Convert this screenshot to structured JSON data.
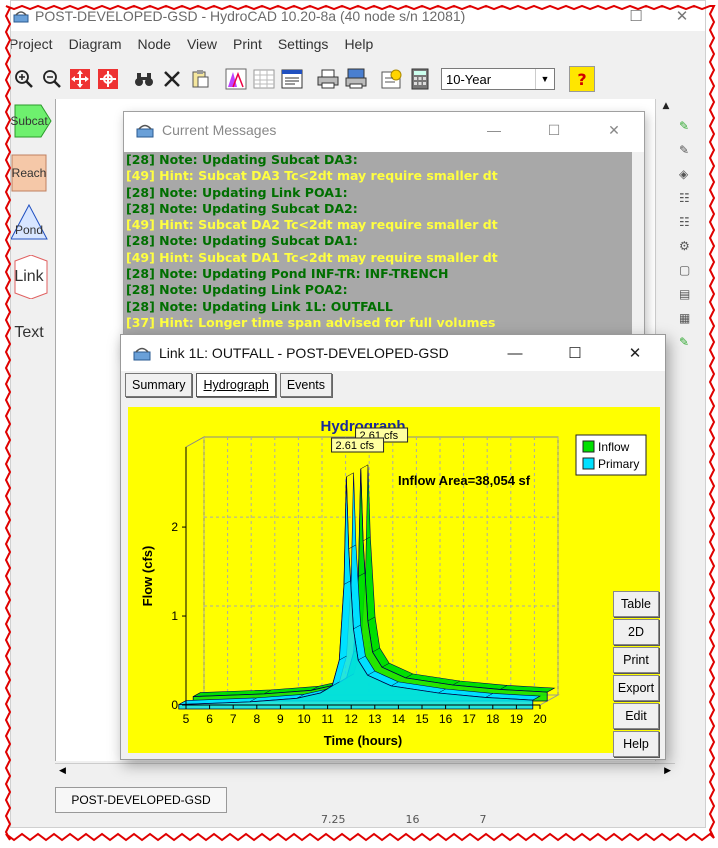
{
  "app": {
    "title": "POST-DEVELOPED-GSD - HydroCAD 10.20-8a  (40 node s/n 12081)"
  },
  "menu": [
    "Project",
    "Diagram",
    "Node",
    "View",
    "Print",
    "Settings",
    "Help"
  ],
  "toolbar": {
    "storm_select": "10-Year"
  },
  "palette": [
    "Subcat",
    "Reach",
    "Pond",
    "Link",
    "Text"
  ],
  "messages_window": {
    "title": "Current Messages",
    "lines": [
      {
        "kind": "note",
        "text": "[28] Note: Updating Subcat DA3:"
      },
      {
        "kind": "hint",
        "text": "[49] Hint: Subcat DA3 Tc<2dt may require smaller dt"
      },
      {
        "kind": "note",
        "text": "[28] Note: Updating Link POA1:"
      },
      {
        "kind": "note",
        "text": "[28] Note: Updating Subcat DA2:"
      },
      {
        "kind": "hint",
        "text": "[49] Hint: Subcat DA2 Tc<2dt may require smaller dt"
      },
      {
        "kind": "note",
        "text": "[28] Note: Updating Subcat DA1:"
      },
      {
        "kind": "hint",
        "text": "[49] Hint: Subcat DA1 Tc<2dt may require smaller dt"
      },
      {
        "kind": "note",
        "text": "[28] Note: Updating Pond INF-TR: INF-TRENCH"
      },
      {
        "kind": "note",
        "text": "[28] Note: Updating Link POA2:"
      },
      {
        "kind": "note",
        "text": "[28] Note: Updating Link 1L: OUTFALL"
      },
      {
        "kind": "hint",
        "text": "[37] Hint: Longer time span advised for full volumes"
      }
    ],
    "colors": {
      "note": "#006f00",
      "hint": "#ffff40",
      "background": "#a8a8a8"
    }
  },
  "link_window": {
    "title": "Link 1L: OUTFALL - POST-DEVELOPED-GSD",
    "tabs": [
      "Summary",
      "Hydrograph",
      "Events"
    ],
    "active_tab": "Hydrograph",
    "side_buttons": [
      "Table",
      "2D",
      "Print",
      "Export",
      "Edit",
      "Help"
    ]
  },
  "chart_data": {
    "type": "area",
    "title": "Hydrograph",
    "xlabel": "Time  (hours)",
    "ylabel": "Flow  (cfs)",
    "x_ticks": [
      5,
      6,
      7,
      8,
      9,
      10,
      11,
      12,
      13,
      14,
      15,
      16,
      17,
      18,
      19,
      20
    ],
    "y_ticks": [
      0,
      1,
      2
    ],
    "xlim": [
      5,
      20
    ],
    "ylim": [
      0,
      2.9
    ],
    "annotation": "Inflow Area=38,054 sf",
    "peak_labels": [
      "2.61 cfs",
      "2.61 cfs"
    ],
    "legend": {
      "placement": "top-right"
    },
    "series": [
      {
        "name": "Inflow",
        "color": "#00e000",
        "x": [
          5,
          8,
          10,
          11,
          11.5,
          11.8,
          12.0,
          12.1,
          12.2,
          12.4,
          12.6,
          13,
          14,
          16,
          18,
          20
        ],
        "y": [
          0.05,
          0.08,
          0.12,
          0.18,
          0.26,
          0.55,
          1.4,
          2.61,
          1.8,
          0.9,
          0.55,
          0.38,
          0.26,
          0.18,
          0.13,
          0.1
        ]
      },
      {
        "name": "Primary",
        "color": "#00e0ff",
        "x": [
          5,
          8,
          10,
          11,
          11.5,
          11.8,
          12.0,
          12.1,
          12.2,
          12.4,
          12.6,
          13,
          14,
          16,
          18,
          20
        ],
        "y": [
          0.05,
          0.08,
          0.12,
          0.18,
          0.26,
          0.55,
          1.4,
          2.61,
          1.8,
          0.9,
          0.55,
          0.38,
          0.26,
          0.18,
          0.13,
          0.1
        ]
      }
    ],
    "grid": true,
    "background": "#ffff00"
  },
  "sheet_tab": "POST-DEVELOPED-GSD",
  "status": [
    "7.25",
    "16",
    "7"
  ]
}
